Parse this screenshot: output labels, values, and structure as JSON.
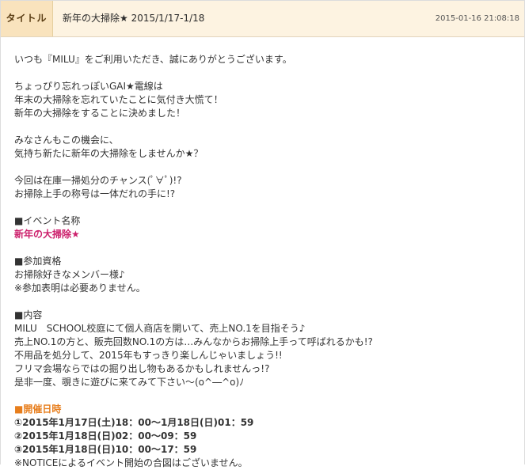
{
  "header": {
    "label": "タイトル",
    "title": "新年の大掃除★ 2015/1/17-1/18",
    "date": "2015-01-16 21:08:18"
  },
  "content": {
    "intro": "いつも『MILU』をご利用いただき、誠にありがとうございます。",
    "p1": [
      "ちょっぴり忘れっぽいGAI★電線は",
      "年末の大掃除を忘れていたことに気付き大慌て！",
      "新年の大掃除をすることに決めました！"
    ],
    "p2": [
      "みなさんもこの機会に、",
      "気持ち新たに新年の大掃除をしませんか★？"
    ],
    "p3": [
      "今回は在庫一掃処分のチャンス(ﾟ∀ﾟ)!?",
      "お掃除上手の称号は一体だれの手に!?"
    ],
    "event_name": {
      "heading": "■イベント名称",
      "value": "新年の大掃除★"
    },
    "eligibility": {
      "heading": "■参加資格",
      "lines": [
        "お掃除好きなメンバー様♪",
        "※参加表明は必要ありません。"
      ]
    },
    "details": {
      "heading": "■内容",
      "lines": [
        "MILU　SCHOOL校庭にて個人商店を開いて、売上NO.1を目指そう♪",
        "売上NO.1の方と、販売回数NO.1の方は…みんなからお掃除上手って呼ばれるかも!?",
        "不用品を処分して、2015年もすっきり楽しんじゃいましょう!!",
        "フリマ会場ならではの掘り出し物もあるかもしれませんっ!?",
        "是非一度、覗きに遊びに来てみて下さい～(o^―^o)ﾉ"
      ]
    },
    "schedule": {
      "heading": "■開催日時",
      "lines": [
        "①2015年1月17日(土)18：00～1月18日(日)01：59",
        "②2015年1月18日(日)02：00～09：59",
        "③2015年1月18日(日)10：00～17：59"
      ],
      "note": "※NOTICEによるイベント開始の合図はございません。"
    }
  }
}
